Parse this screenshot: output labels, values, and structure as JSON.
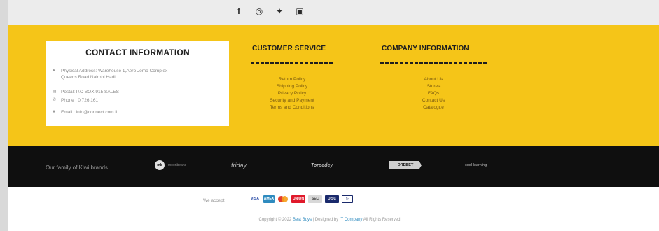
{
  "social": {
    "icons": [
      "facebook-icon",
      "instagram-icon",
      "twitter-icon",
      "linkedin-icon"
    ],
    "glyphs": [
      "f",
      "◎",
      "✦",
      "▣"
    ]
  },
  "contact": {
    "title": "CONTACT INFORMATION",
    "address": "Physical Address: Warehouse 1,Aero Jomo Complex",
    "address2": "Queens Road Nairobi Hadi",
    "postal": "Postal: P.O BOX 915 SALES",
    "phone": "Phone : 0 726 161",
    "email": "Email : info@connect.com.li"
  },
  "customer_service": {
    "title": "CUSTOMER SERVICE",
    "links": [
      "Return Policy",
      "Shipping Policy",
      "Privacy Policy",
      "Security and Payment",
      "Terms and Conditions"
    ]
  },
  "company_info": {
    "title": "COMPANY INFORMATION",
    "links": [
      "About Us",
      "Stores",
      "FAQs",
      "Contact Us",
      "Catalogue"
    ]
  },
  "brands": {
    "lead": "Our family of Kiwi brands",
    "items": [
      "moonbeans",
      "friday",
      "Torpedey",
      "DREBET",
      "cool learning"
    ]
  },
  "payments": {
    "label": "We accept",
    "cards": [
      "VISA",
      "AMEX",
      "MC",
      "UNION",
      "SEC",
      "DISC",
      "▷"
    ]
  },
  "copyright": {
    "prefix": "Copyright © 2022",
    "brand": "Best Buys",
    "middle": "| Designed by",
    "designer": "IT Company",
    "suffix": "All Rights Reserved"
  },
  "colors": {
    "yellow": "#f5c518",
    "black": "#0f0f0f",
    "visa": "#1a3fa0",
    "amex": "#2e8bbf",
    "mastercard_red": "#e23c2e",
    "mastercard_orange": "#f59e1b",
    "unionpay_red": "#e01a2b"
  }
}
